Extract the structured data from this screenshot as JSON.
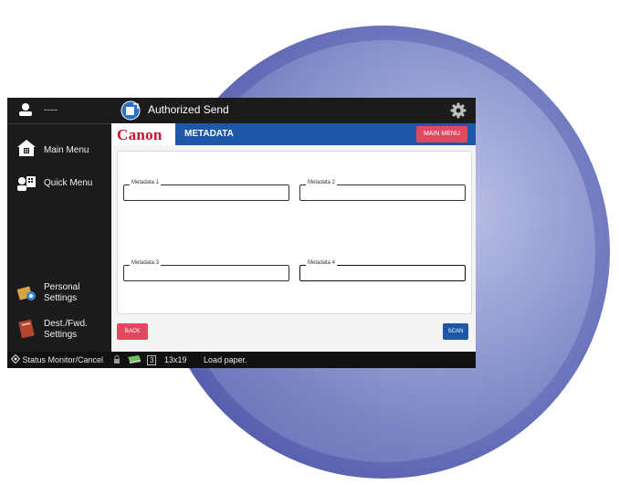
{
  "sidebar": {
    "user_name": "-----",
    "items": [
      {
        "label": "Main Menu",
        "icon": "home-icon"
      },
      {
        "label": "Quick Menu",
        "icon": "quick-menu-icon"
      },
      {
        "label_line1": "Personal",
        "label_line2": "Settings",
        "icon": "personal-settings-icon"
      },
      {
        "label_line1": "Dest./Fwd.",
        "label_line2": "Settings",
        "icon": "address-book-icon"
      }
    ]
  },
  "app": {
    "title": "Authorized Send",
    "brand": "Canon",
    "page_title": "METADATA",
    "main_menu_label": "MAIN MENU"
  },
  "fields": [
    {
      "label": "Metadata 1",
      "value": ""
    },
    {
      "label": "Metadata 2",
      "value": ""
    },
    {
      "label": "Metadata 3",
      "value": ""
    },
    {
      "label": "Metadata 4",
      "value": ""
    }
  ],
  "footer": {
    "back_label": "BACK",
    "scan_label": "SCAN"
  },
  "status": {
    "monitor_label": "Status Monitor/Cancel",
    "tray_number": "3",
    "paper_size": "13x19",
    "message": "Load paper."
  },
  "colors": {
    "accent_blue": "#1e56a8",
    "accent_red": "#e04a5e",
    "brand_red": "#c8102e"
  }
}
